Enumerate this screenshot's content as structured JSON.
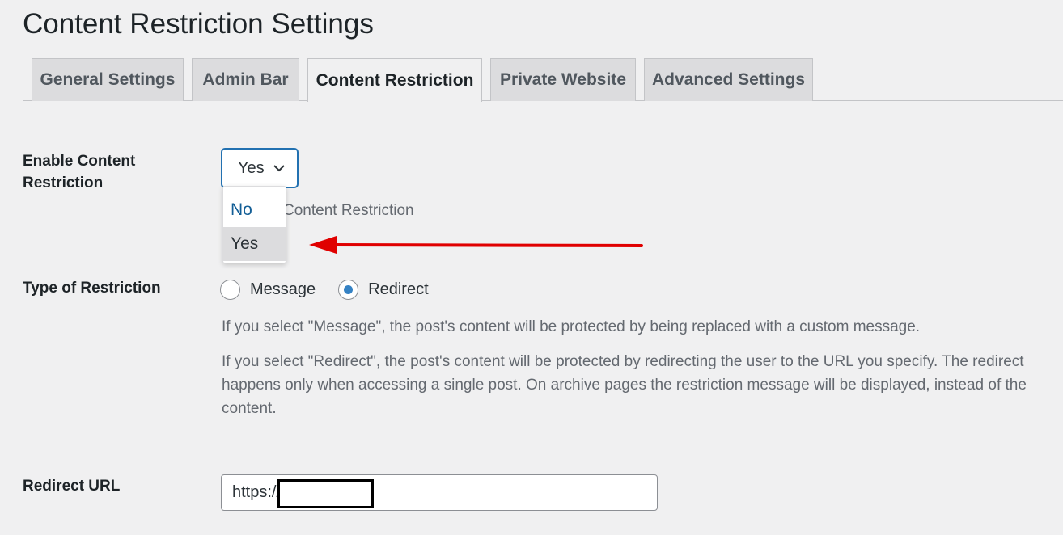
{
  "page": {
    "title": "Content Restriction Settings"
  },
  "tabs": [
    {
      "label": "General Settings",
      "active": false
    },
    {
      "label": "Admin Bar",
      "active": false
    },
    {
      "label": "Content Restriction",
      "active": true
    },
    {
      "label": "Private Website",
      "active": false
    },
    {
      "label": "Advanced Settings",
      "active": false
    }
  ],
  "enable_restriction": {
    "label": "Enable Content\nRestriction",
    "selected": "Yes",
    "options": [
      "No",
      "Yes"
    ],
    "description_visible": "Content Restriction",
    "chevron_icon": "chevron-down-icon"
  },
  "type_of_restriction": {
    "label": "Type of Restriction",
    "options": [
      {
        "label": "Message",
        "checked": false
      },
      {
        "label": "Redirect",
        "checked": true
      }
    ],
    "desc_message": "If you select \"Message\", the post's content will be protected by being replaced with a custom message.",
    "desc_redirect": "If you select \"Redirect\", the post's content will be protected by redirecting the user to the URL you specify. The redirect happens only when accessing a single post. On archive pages the restriction message will be displayed, instead of the content."
  },
  "redirect_url": {
    "label": "Redirect URL",
    "value": "https://"
  },
  "annotation": {
    "arrow_color": "#e00000"
  },
  "colors": {
    "accent": "#2271b1",
    "background": "#f0f0f1"
  }
}
